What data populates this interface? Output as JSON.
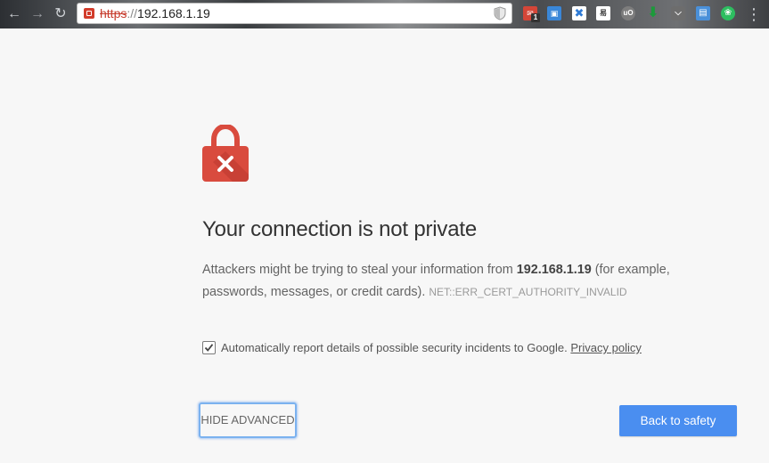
{
  "browser": {
    "url_scheme": "https",
    "url_separator": "://",
    "url_host": "192.168.1.19",
    "nav": {
      "back_icon": "back-arrow-icon",
      "forward_icon": "forward-arrow-icon",
      "reload_icon": "reload-icon"
    },
    "extensions": [
      {
        "name": "extension-gmail-icon",
        "color": "#d44638",
        "badge": "1"
      },
      {
        "name": "extension-window-icon",
        "color": "#3a87d8"
      },
      {
        "name": "extension-blue-x-icon",
        "color": "#2f7bd6"
      },
      {
        "name": "extension-translate-icon",
        "color": "#555555"
      },
      {
        "name": "extension-ublock-icon",
        "color": "#7d7d7d"
      },
      {
        "name": "extension-download-arrow-icon",
        "color": "#1b9a3a"
      },
      {
        "name": "extension-pocket-icon",
        "color": "#6d6d6d"
      },
      {
        "name": "extension-folder-icon",
        "color": "#4a90d9"
      },
      {
        "name": "extension-evernote-icon",
        "color": "#2dbe60"
      }
    ]
  },
  "interstitial": {
    "icon": "red-lock-error-icon",
    "colors": {
      "lock": "#d94b3e",
      "lock_shadow": "#b8362b",
      "accent": "#4a8ef0"
    },
    "title": "Your connection is not private",
    "body_prefix": "Attackers might be trying to steal your information from ",
    "body_host": "192.168.1.19",
    "body_suffix": " (for example, passwords, messages, or credit cards).",
    "error_code": "NET::ERR_CERT_AUTHORITY_INVALID",
    "report_label": "Automatically report details of possible security incidents to Google.",
    "report_checked": true,
    "privacy_link": "Privacy policy",
    "hide_advanced_label": "HIDE ADVANCED",
    "back_to_safety_label": "Back to safety"
  }
}
